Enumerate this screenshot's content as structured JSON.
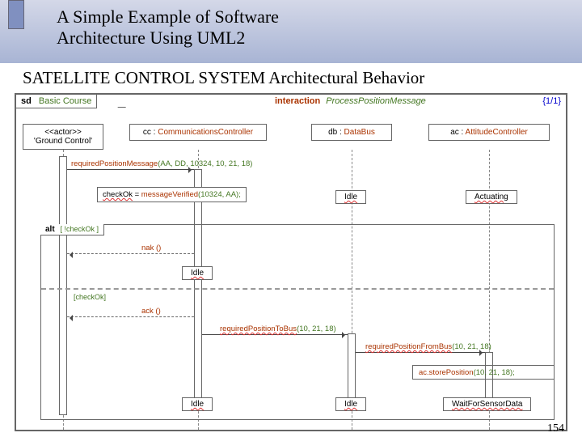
{
  "title": {
    "line1": "A Simple Example of Software",
    "line2": "Architecture Using UML2"
  },
  "subtitle": "SATELLITE CONTROL SYSTEM Architectural Behavior",
  "frame": {
    "kind": "sd",
    "name": "Basic Course"
  },
  "interaction": {
    "kw": "interaction",
    "name": "ProcessPositionMessage"
  },
  "pages": "{1/1}",
  "lifelines": {
    "gc": {
      "stereo": "<<actor>>",
      "name": "'Ground Control'"
    },
    "cc": {
      "obj": "cc : ",
      "cls": "CommunicationsController"
    },
    "db": {
      "obj": "db : ",
      "cls": "DataBus"
    },
    "ac": {
      "obj": "ac : ",
      "cls": "AttitudeController"
    }
  },
  "messages": {
    "reqPos": {
      "name": "requiredPositionMessage",
      "params": "(AA, DD, 10324, 10, 21, 18)"
    },
    "verify": {
      "var": "checkOk",
      "fn": "messageVerified",
      "params": "(10324, AA);"
    },
    "nak": "nak ()",
    "ack": "ack ()",
    "reqToBus": {
      "name": "requiredPositionToBus",
      "params": "(10, 21, 18)"
    },
    "reqFromBus": {
      "name": "requiredPositionFromBus",
      "params": "(10, 21, 18)"
    },
    "store": {
      "name": "ac.storePosition",
      "params": "(10, 21, 18);"
    }
  },
  "states": {
    "idle": "Idle",
    "actuating": "Actuating",
    "waitSensor": "WaitForSensorData"
  },
  "alt": {
    "kw": "alt",
    "guard1": "[ !checkOk ]",
    "guard2": "[checkOk]"
  },
  "pageNum": "154",
  "chart_data": {
    "type": "sequence-diagram",
    "frame": "sd Basic Course",
    "interaction": "ProcessPositionMessage",
    "lifelines": [
      "'Ground Control' <<actor>>",
      "cc : CommunicationsController",
      "db : DataBus",
      "ac : AttitudeController"
    ],
    "initial_states": {
      "db": "Idle",
      "ac": "Actuating"
    },
    "events": [
      {
        "from": "Ground Control",
        "to": "cc",
        "message": "requiredPositionMessage(AA, DD, 10324, 10, 21, 18)"
      },
      {
        "at": "cc",
        "action": "checkOk = messageVerified(10324, AA);"
      },
      {
        "fragment": "alt",
        "operands": [
          {
            "guard": "!checkOk",
            "events": [
              {
                "from": "cc",
                "to": "Ground Control",
                "message": "nak()",
                "kind": "return"
              },
              {
                "at": "cc",
                "state": "Idle"
              }
            ]
          },
          {
            "guard": "checkOk",
            "events": [
              {
                "from": "cc",
                "to": "Ground Control",
                "message": "ack()",
                "kind": "return"
              },
              {
                "from": "cc",
                "to": "db",
                "message": "requiredPositionToBus(10, 21, 18)"
              },
              {
                "from": "db",
                "to": "ac",
                "message": "requiredPositionFromBus(10, 21, 18)"
              },
              {
                "at": "ac",
                "action": "ac.storePosition(10, 21, 18);"
              },
              {
                "at": "cc",
                "state": "Idle"
              },
              {
                "at": "db",
                "state": "Idle"
              },
              {
                "at": "ac",
                "state": "WaitForSensorData"
              }
            ]
          }
        ]
      }
    ]
  }
}
